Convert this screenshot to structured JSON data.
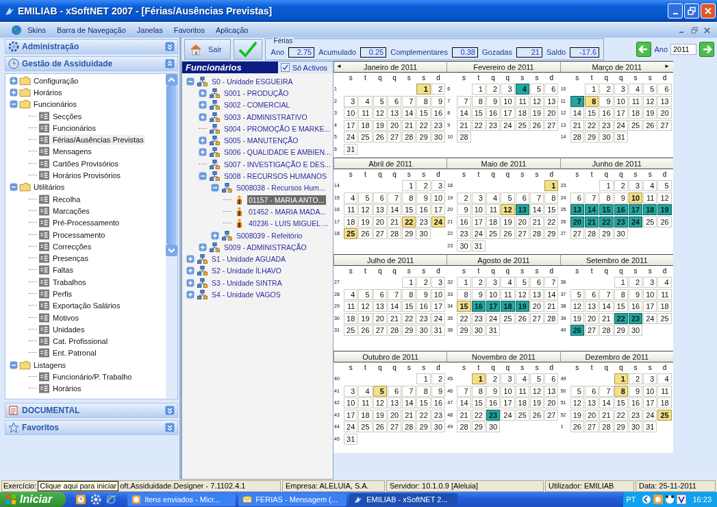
{
  "window": {
    "title": "EMILIAB - xSoftNET 2007 - [Férias/Ausências Previstas]"
  },
  "menu": [
    "Skins",
    "Barra de Navegação",
    "Janelas",
    "Favoritos",
    "Aplicação"
  ],
  "sidebar": {
    "sections": [
      {
        "title": "Administração",
        "kind": "gear",
        "expanded": false
      },
      {
        "title": "Gestão de Assiduidade",
        "kind": "clock",
        "expanded": true,
        "items": [
          {
            "label": "Configuração",
            "kind": "folder",
            "expanded": false,
            "selected": false
          },
          {
            "label": "Horários",
            "kind": "folder",
            "expanded": false,
            "selected": false
          },
          {
            "label": "Funcionários",
            "kind": "folder",
            "expanded": true,
            "selected": false,
            "children": [
              {
                "label": "Secções",
                "kind": "form",
                "selected": false
              },
              {
                "label": "Funcionários",
                "kind": "form",
                "selected": false
              },
              {
                "label": "Férias/Ausências Previstas",
                "kind": "form",
                "selected": true
              },
              {
                "label": "Mensagens",
                "kind": "form",
                "selected": false
              },
              {
                "label": "Cartões Provisórios",
                "kind": "form",
                "selected": false
              },
              {
                "label": "Horários Provisórios",
                "kind": "form",
                "selected": false
              }
            ]
          },
          {
            "label": "Utilitários",
            "kind": "folder",
            "expanded": true,
            "selected": false,
            "children": [
              {
                "label": "Recolha",
                "kind": "form",
                "selected": false
              },
              {
                "label": "Marcações",
                "kind": "form",
                "selected": false
              },
              {
                "label": "Pré-Processamento",
                "kind": "form",
                "selected": false
              },
              {
                "label": "Processamento",
                "kind": "form",
                "selected": false
              },
              {
                "label": "Correcções",
                "kind": "form",
                "selected": false
              },
              {
                "label": "Presenças",
                "kind": "form",
                "selected": false
              },
              {
                "label": "Faltas",
                "kind": "form",
                "selected": false
              },
              {
                "label": "Trabalhos",
                "kind": "form",
                "selected": false
              },
              {
                "label": "Perfis",
                "kind": "form",
                "selected": false
              },
              {
                "label": "Exportação Salários",
                "kind": "form",
                "selected": false
              },
              {
                "label": "Motivos",
                "kind": "form",
                "selected": false
              },
              {
                "label": "Unidades",
                "kind": "form",
                "selected": false
              },
              {
                "label": "Cat. Profissional",
                "kind": "form",
                "selected": false
              },
              {
                "label": "Ent. Patronal",
                "kind": "form",
                "selected": false
              }
            ]
          },
          {
            "label": "Listagens",
            "kind": "folder",
            "expanded": true,
            "selected": false,
            "children": [
              {
                "label": "Funcionário/P. Trabalho",
                "kind": "form",
                "selected": false
              },
              {
                "label": "Horários",
                "kind": "form",
                "selected": false
              }
            ]
          }
        ]
      },
      {
        "title": "DOCUMENTAL",
        "kind": "document",
        "expanded": false
      },
      {
        "title": "Favoritos",
        "kind": "star",
        "expanded": false
      }
    ]
  },
  "toolbar": {
    "exit": "Sair",
    "ferias": {
      "legend": "Férias",
      "fields": [
        {
          "label": "Ano",
          "value": "2.75"
        },
        {
          "label": "Acumulado",
          "value": "0.25"
        },
        {
          "label": "Complementares",
          "value": "0.38"
        },
        {
          "label": "Gozadas",
          "value": "21"
        },
        {
          "label": "Saldo",
          "value": "-17.6"
        }
      ]
    },
    "year": {
      "label": "Ano",
      "value": "2011"
    }
  },
  "employees": {
    "title": "Funcionários",
    "filter": {
      "label": "Só Activos",
      "checked": true
    },
    "nodes": [
      {
        "label": "S0 - Unidade ESGUEIRA",
        "kind": "unit",
        "expanded": true,
        "selected": false,
        "children": [
          {
            "label": "S001 - PRODUÇÃO",
            "kind": "unit",
            "expanded": false,
            "selected": false
          },
          {
            "label": "S002 - COMERCIAL",
            "kind": "unit",
            "expanded": false,
            "selected": false
          },
          {
            "label": "S003 - ADMINISTRATIVO",
            "kind": "unit",
            "expanded": false,
            "selected": false
          },
          {
            "label": "S004 - PROMOÇÃO E MARKE...",
            "kind": "unit",
            "selected": false
          },
          {
            "label": "S005 - MANUTENÇÃO",
            "kind": "unit",
            "expanded": false,
            "selected": false
          },
          {
            "label": "S006 - QUALIDADE E AMBIEN...",
            "kind": "unit",
            "expanded": false,
            "selected": false
          },
          {
            "label": "S007 - INVESTIGAÇÃO E DES...",
            "kind": "unit",
            "selected": false
          },
          {
            "label": "S008 - RECURSOS HUMANOS",
            "kind": "unit",
            "expanded": true,
            "selected": false,
            "children": [
              {
                "label": "S008038 - Recursos Hum...",
                "kind": "unit",
                "expanded": true,
                "selected": false,
                "children": [
                  {
                    "label": "01157 - MARIA ANTO...",
                    "kind": "person",
                    "selected": true
                  },
                  {
                    "label": "01452 - MARIA MADA...",
                    "kind": "person",
                    "selected": false
                  },
                  {
                    "label": "40236 - LUIS MIGUEL ...",
                    "kind": "person",
                    "selected": false
                  }
                ]
              },
              {
                "label": "S008039 - Refeitório",
                "kind": "unit",
                "expanded": false,
                "selected": false
              }
            ]
          },
          {
            "label": "S009 - ADMINISTRAÇÃO",
            "kind": "unit",
            "expanded": false,
            "selected": false
          }
        ]
      },
      {
        "label": "S1 - Unidade AGUADA",
        "kind": "unit",
        "expanded": false,
        "selected": false
      },
      {
        "label": "S2 - Unidade ÍLHAVO",
        "kind": "unit",
        "expanded": false,
        "selected": false
      },
      {
        "label": "S3 - Unidade SINTRA",
        "kind": "unit",
        "expanded": false,
        "selected": false
      },
      {
        "label": "S4 - Unidade VAGOS",
        "kind": "unit",
        "expanded": false,
        "selected": false
      }
    ]
  },
  "calendar": {
    "months": [
      {
        "title": "Janeiro de 2011",
        "prev_arrow": "◄",
        "weekdays": [
          "s",
          "t",
          "q",
          "q",
          "s",
          "s",
          "d"
        ],
        "weeks": [
          {
            "num": "1",
            "first": true,
            "days": [
              {
                "day": "1",
                "kind": "holiday"
              },
              "2"
            ]
          },
          {
            "num": "2",
            "days": [
              "3",
              "4",
              "5",
              "6",
              "7",
              "8",
              "9"
            ]
          },
          {
            "num": "3",
            "days": [
              "10",
              "11",
              "12",
              "13",
              "14",
              "15",
              "16"
            ]
          },
          {
            "num": "4",
            "days": [
              "17",
              "18",
              "19",
              "20",
              "21",
              "22",
              "23"
            ]
          },
          {
            "num": "5",
            "days": [
              "24",
              "25",
              "26",
              "27",
              "28",
              "29",
              "30"
            ]
          },
          {
            "num": "6",
            "days": [
              "31"
            ]
          }
        ]
      },
      {
        "title": "Fevereiro de 2011",
        "weekdays": [
          "s",
          "t",
          "q",
          "q",
          "s",
          "s",
          "d"
        ],
        "weeks": [
          {
            "num": "6",
            "first": true,
            "days": [
              "1",
              "2",
              "3",
              {
                "day": "4",
                "kind": "absence"
              },
              "5",
              "6"
            ]
          },
          {
            "num": "7",
            "days": [
              "7",
              "8",
              "9",
              "10",
              "11",
              "12",
              "13"
            ]
          },
          {
            "num": "8",
            "days": [
              "14",
              "15",
              "16",
              "17",
              "18",
              "19",
              "20"
            ]
          },
          {
            "num": "9",
            "days": [
              "21",
              "22",
              "23",
              "24",
              "25",
              "26",
              "27"
            ]
          },
          {
            "num": "10",
            "days": [
              "28"
            ]
          }
        ]
      },
      {
        "title": "Março de 2011",
        "next_arrow": "►",
        "weekdays": [
          "s",
          "t",
          "q",
          "q",
          "s",
          "s",
          "d"
        ],
        "weeks": [
          {
            "num": "10",
            "first": true,
            "days": [
              "1",
              "2",
              "3",
              "4",
              "5",
              "6"
            ]
          },
          {
            "num": "11",
            "days": [
              {
                "day": "7",
                "kind": "absence"
              },
              {
                "day": "8",
                "kind": "holiday"
              },
              "9",
              "10",
              "11",
              "12",
              "13"
            ]
          },
          {
            "num": "12",
            "days": [
              "14",
              "15",
              "16",
              "17",
              "18",
              "19",
              "20"
            ]
          },
          {
            "num": "13",
            "days": [
              "21",
              "22",
              "23",
              "24",
              "25",
              "26",
              "27"
            ]
          },
          {
            "num": "14",
            "days": [
              "28",
              "29",
              "30",
              "31"
            ]
          }
        ]
      },
      {
        "title": "Abril de 2011",
        "weekdays": [
          "s",
          "t",
          "q",
          "q",
          "s",
          "s",
          "d"
        ],
        "weeks": [
          {
            "num": "14",
            "first": true,
            "days": [
              "1",
              "2",
              "3"
            ]
          },
          {
            "num": "15",
            "days": [
              "4",
              "5",
              "6",
              "7",
              "8",
              "9",
              "10"
            ]
          },
          {
            "num": "16",
            "days": [
              "11",
              "12",
              "13",
              "14",
              "15",
              "16",
              "17"
            ]
          },
          {
            "num": "17",
            "days": [
              "18",
              "19",
              "20",
              "21",
              {
                "day": "22",
                "kind": "holiday"
              },
              "23",
              {
                "day": "24",
                "kind": "holiday"
              }
            ]
          },
          {
            "num": "18",
            "days": [
              {
                "day": "25",
                "kind": "holiday"
              },
              "26",
              "27",
              "28",
              "29",
              "30"
            ]
          }
        ]
      },
      {
        "title": "Maio de 2011",
        "weekdays": [
          "s",
          "t",
          "q",
          "q",
          "s",
          "s",
          "d"
        ],
        "weeks": [
          {
            "num": "18",
            "first": true,
            "days": [
              {
                "day": "1",
                "kind": "holiday"
              }
            ]
          },
          {
            "num": "19",
            "days": [
              "2",
              "3",
              "4",
              "5",
              "6",
              "7",
              "8"
            ]
          },
          {
            "num": "20",
            "days": [
              "9",
              "10",
              "11",
              {
                "day": "12",
                "kind": "holiday"
              },
              {
                "day": "13",
                "kind": "absence"
              },
              "14",
              "15"
            ]
          },
          {
            "num": "21",
            "days": [
              "16",
              "17",
              "18",
              "19",
              "20",
              "21",
              "22"
            ]
          },
          {
            "num": "22",
            "days": [
              "23",
              "24",
              "25",
              "26",
              "27",
              "28",
              "29"
            ]
          },
          {
            "num": "23",
            "days": [
              "30",
              "31"
            ]
          }
        ]
      },
      {
        "title": "Junho de 2011",
        "weekdays": [
          "s",
          "t",
          "q",
          "q",
          "s",
          "s",
          "d"
        ],
        "weeks": [
          {
            "num": "23",
            "first": true,
            "days": [
              "1",
              "2",
              "3",
              "4",
              "5"
            ]
          },
          {
            "num": "24",
            "days": [
              "6",
              "7",
              "8",
              "9",
              {
                "day": "10",
                "kind": "holiday"
              },
              "11",
              "12"
            ]
          },
          {
            "num": "25",
            "days": [
              {
                "day": "13",
                "kind": "absence"
              },
              {
                "day": "14",
                "kind": "absence"
              },
              {
                "day": "15",
                "kind": "absence"
              },
              {
                "day": "16",
                "kind": "absence"
              },
              {
                "day": "17",
                "kind": "absence"
              },
              {
                "day": "18",
                "kind": "absence"
              },
              {
                "day": "19",
                "kind": "absence"
              }
            ]
          },
          {
            "num": "26",
            "days": [
              {
                "day": "20",
                "kind": "absence"
              },
              {
                "day": "21",
                "kind": "absence"
              },
              {
                "day": "22",
                "kind": "absence"
              },
              {
                "day": "23",
                "kind": "absence"
              },
              {
                "day": "24",
                "kind": "absence"
              },
              "25",
              "26"
            ]
          },
          {
            "num": "27",
            "days": [
              "27",
              "28",
              "29",
              "30"
            ]
          }
        ]
      },
      {
        "title": "Julho de 2011",
        "weekdays": [
          "s",
          "t",
          "q",
          "q",
          "s",
          "s",
          "d"
        ],
        "weeks": [
          {
            "num": "27",
            "first": true,
            "days": [
              "1",
              "2",
              "3"
            ]
          },
          {
            "num": "28",
            "days": [
              "4",
              "5",
              "6",
              "7",
              "8",
              "9",
              "10"
            ]
          },
          {
            "num": "29",
            "days": [
              "11",
              "12",
              "13",
              "14",
              "15",
              "16",
              "17"
            ]
          },
          {
            "num": "30",
            "days": [
              "18",
              "19",
              "20",
              "21",
              "22",
              "23",
              "24"
            ]
          },
          {
            "num": "31",
            "days": [
              "25",
              "26",
              "27",
              "28",
              "29",
              "30",
              "31"
            ]
          }
        ]
      },
      {
        "title": "Agosto de 2011",
        "weekdays": [
          "s",
          "t",
          "q",
          "q",
          "s",
          "s",
          "d"
        ],
        "weeks": [
          {
            "num": "32",
            "first": true,
            "days": [
              "1",
              "2",
              "3",
              "4",
              "5",
              "6",
              "7"
            ]
          },
          {
            "num": "33",
            "days": [
              "8",
              "9",
              "10",
              "11",
              "12",
              "13",
              "14"
            ]
          },
          {
            "num": "34",
            "days": [
              {
                "day": "15",
                "kind": "holiday"
              },
              {
                "day": "16",
                "kind": "absence"
              },
              {
                "day": "17",
                "kind": "absence"
              },
              {
                "day": "18",
                "kind": "absence"
              },
              {
                "day": "19",
                "kind": "absence"
              },
              "20",
              "21"
            ]
          },
          {
            "num": "35",
            "days": [
              "22",
              "23",
              "24",
              "25",
              "26",
              "27",
              "28"
            ]
          },
          {
            "num": "36",
            "days": [
              "29",
              "30",
              "31"
            ]
          }
        ]
      },
      {
        "title": "Setembro de 2011",
        "weekdays": [
          "s",
          "t",
          "q",
          "q",
          "s",
          "s",
          "d"
        ],
        "weeks": [
          {
            "num": "36",
            "first": true,
            "days": [
              "1",
              "2",
              "3",
              "4"
            ]
          },
          {
            "num": "37",
            "days": [
              "5",
              "6",
              "7",
              "8",
              "9",
              "10",
              "11"
            ]
          },
          {
            "num": "38",
            "days": [
              "12",
              "13",
              "14",
              "15",
              "16",
              "17",
              "18"
            ]
          },
          {
            "num": "39",
            "days": [
              "19",
              "20",
              "21",
              {
                "day": "22",
                "kind": "absence"
              },
              {
                "day": "23",
                "kind": "absence"
              },
              "24",
              "25"
            ]
          },
          {
            "num": "40",
            "days": [
              {
                "day": "26",
                "kind": "absence"
              },
              "27",
              "28",
              "29",
              "30"
            ]
          }
        ]
      },
      {
        "title": "Outubro de 2011",
        "weekdays": [
          "s",
          "t",
          "q",
          "q",
          "s",
          "s",
          "d"
        ],
        "weeks": [
          {
            "num": "40",
            "first": true,
            "days": [
              "1",
              "2"
            ]
          },
          {
            "num": "41",
            "days": [
              "3",
              "4",
              {
                "day": "5",
                "kind": "holiday"
              },
              "6",
              "7",
              "8",
              "9"
            ]
          },
          {
            "num": "42",
            "days": [
              "10",
              "11",
              "12",
              "13",
              "14",
              "15",
              "16"
            ]
          },
          {
            "num": "43",
            "days": [
              "17",
              "18",
              "19",
              "20",
              "21",
              "22",
              "23"
            ]
          },
          {
            "num": "44",
            "days": [
              "24",
              "25",
              "26",
              "27",
              "28",
              "29",
              "30"
            ]
          },
          {
            "num": "45",
            "days": [
              "31"
            ]
          }
        ]
      },
      {
        "title": "Novembro de 2011",
        "weekdays": [
          "s",
          "t",
          "q",
          "q",
          "s",
          "s",
          "d"
        ],
        "weeks": [
          {
            "num": "45",
            "first": true,
            "days": [
              {
                "day": "1",
                "kind": "holiday"
              },
              "2",
              "3",
              "4",
              "5",
              "6"
            ]
          },
          {
            "num": "46",
            "days": [
              "7",
              "8",
              "9",
              "10",
              "11",
              "12",
              "13"
            ]
          },
          {
            "num": "47",
            "days": [
              "14",
              "15",
              "16",
              "17",
              "18",
              "19",
              "20"
            ]
          },
          {
            "num": "48",
            "days": [
              "21",
              "22",
              {
                "day": "23",
                "kind": "absence"
              },
              "24",
              "25",
              "26",
              "27"
            ]
          },
          {
            "num": "49",
            "days": [
              "28",
              "29",
              "30"
            ]
          }
        ]
      },
      {
        "title": "Dezembro de 2011",
        "weekdays": [
          "s",
          "t",
          "q",
          "q",
          "s",
          "s",
          "d"
        ],
        "weeks": [
          {
            "num": "49",
            "first": true,
            "days": [
              {
                "day": "1",
                "kind": "holiday"
              },
              "2",
              "3",
              "4"
            ]
          },
          {
            "num": "50",
            "days": [
              "5",
              "6",
              "7",
              {
                "day": "8",
                "kind": "holiday"
              },
              "9",
              "10",
              "11"
            ]
          },
          {
            "num": "51",
            "days": [
              "12",
              "13",
              "14",
              "15",
              "16",
              "17",
              "18"
            ]
          },
          {
            "num": "52",
            "days": [
              "19",
              "20",
              "21",
              "22",
              "23",
              "24",
              {
                "day": "25",
                "kind": "holiday"
              }
            ]
          },
          {
            "num": "1",
            "days": [
              "26",
              "27",
              "28",
              "29",
              "30",
              "31"
            ]
          }
        ]
      }
    ]
  },
  "status_bar": {
    "exercise": "Exercício:",
    "tooltip": "Clique aqui para iniciar",
    "version": "oft.Assiduidade.Designer - 7.1102.4.1",
    "company": "Empresa: ALELUIA, S.A.",
    "server": "Servidor: 10.1.0.9 [Aleluia]",
    "user": "Utilizador: EMILIAB",
    "date": "Data: 25-11-2011"
  },
  "taskbar": {
    "start": "Iniciar",
    "tasks": [
      {
        "label": "Itens enviados - Micr...",
        "kind": "clock",
        "selected": false
      },
      {
        "label": "FERIAS - Mensagem (...",
        "kind": "mail",
        "selected": false
      },
      {
        "label": "EMILIAB - xSoftNET 2...",
        "kind": "app",
        "selected": true
      }
    ],
    "language": "PT",
    "clock": "16:23"
  }
}
